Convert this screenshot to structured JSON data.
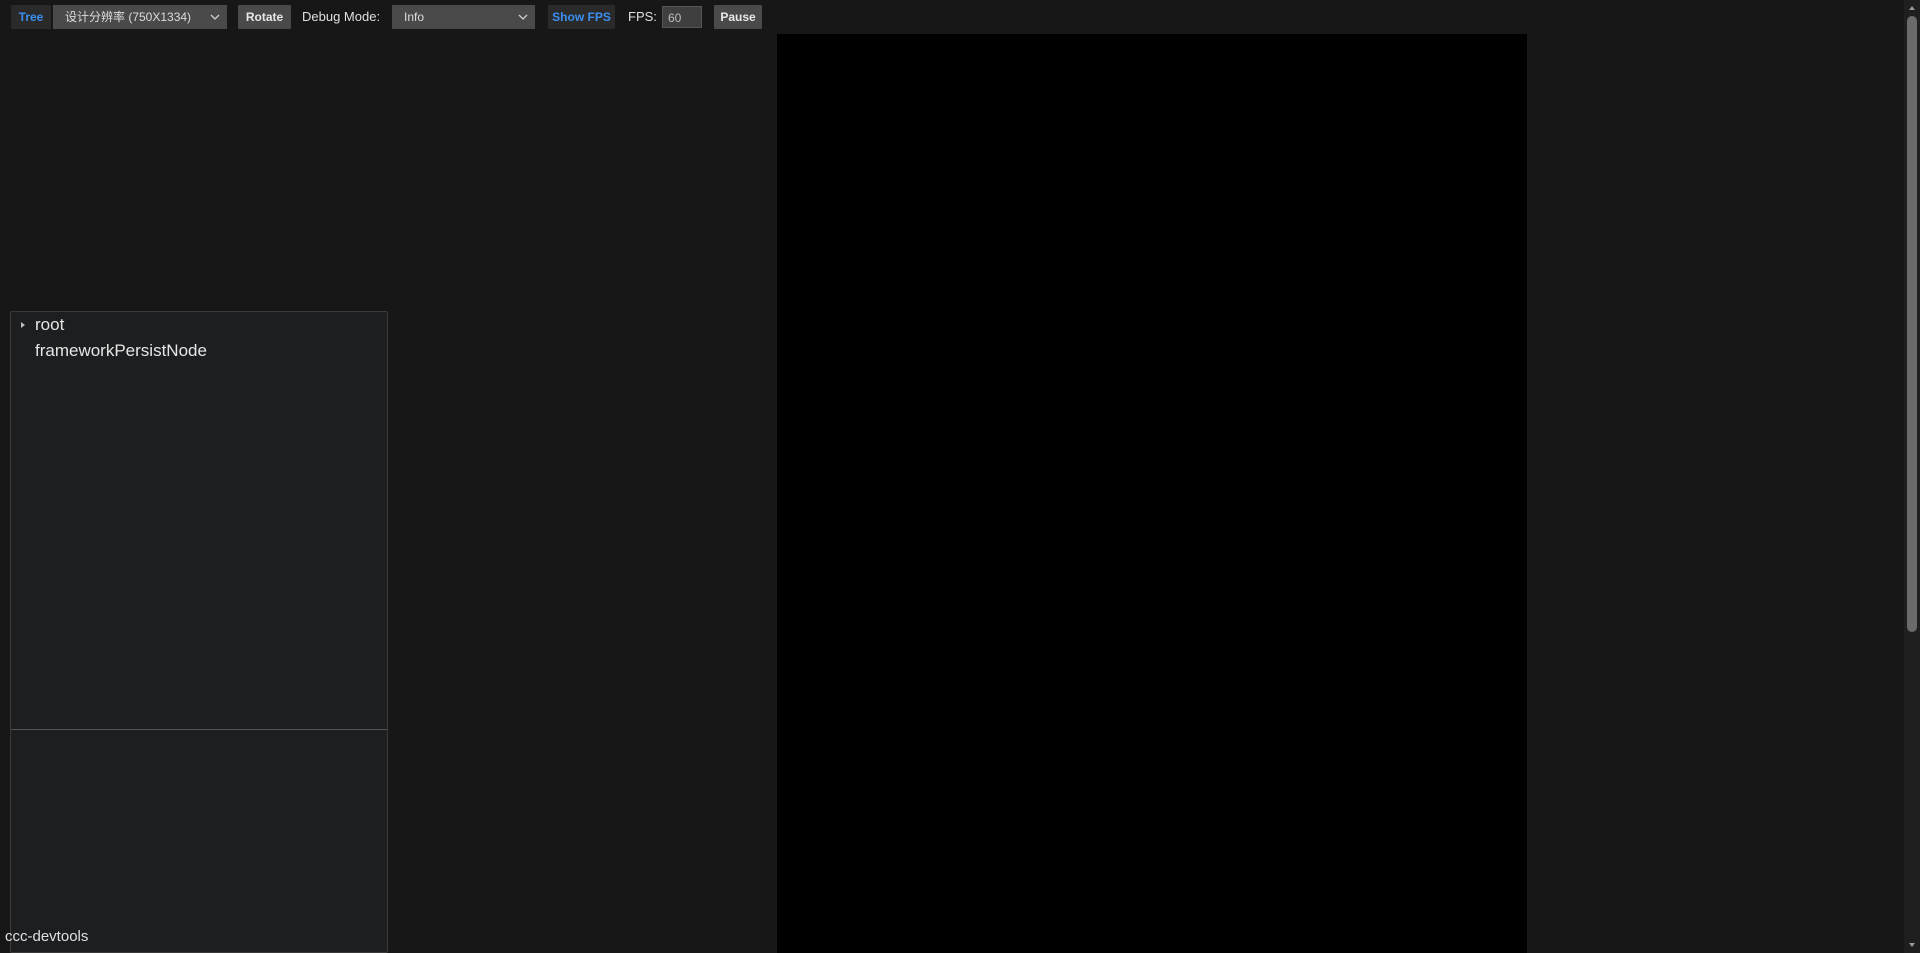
{
  "toolbar": {
    "tree_label": "Tree",
    "resolution_value": "设计分辨率 (750X1334)",
    "rotate_label": "Rotate",
    "debug_mode_label": "Debug Mode:",
    "debug_mode_value": "Info",
    "show_fps_label": "Show FPS",
    "fps_label": "FPS:",
    "fps_value": "60",
    "pause_label": "Pause"
  },
  "tree": {
    "items": [
      {
        "label": "root",
        "expandable": true
      },
      {
        "label": "frameworkPersistNode",
        "expandable": false
      }
    ]
  },
  "footer": {
    "label": "ccc-devtools"
  },
  "colors": {
    "accent": "#3b8ff0",
    "background": "#171717",
    "game_canvas": "#000000"
  }
}
